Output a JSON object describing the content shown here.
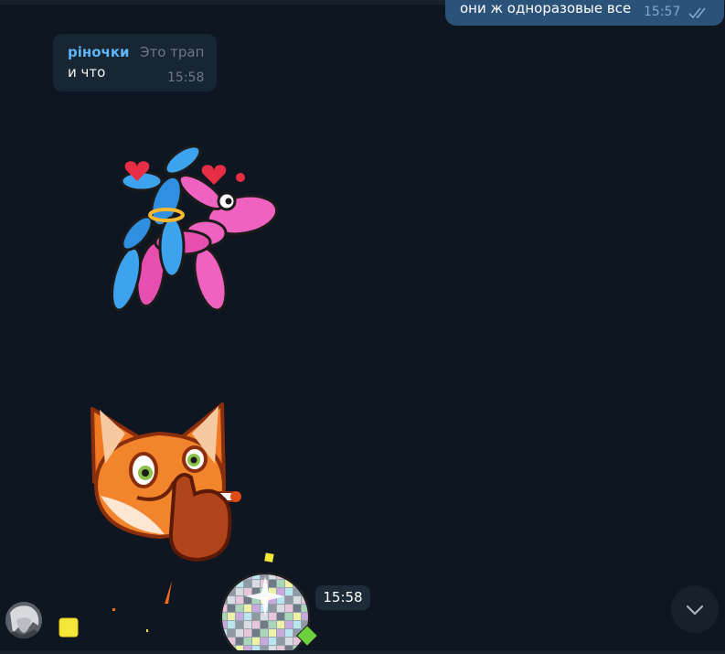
{
  "messages": {
    "outgoing_top": {
      "text": "они ж одноразовые все",
      "time": "15:57",
      "status_icon": "double-check-icon"
    },
    "incoming_reply": {
      "author": "ріночки",
      "quote": "Это трап",
      "text": "и что",
      "time": "15:58"
    },
    "sticker_balloon_dogs": {
      "name": "balloon-dogs-sticker"
    },
    "sticker_fox": {
      "name": "fox-smoking-sticker"
    },
    "sticker_disco": {
      "name": "disco-ball-sticker",
      "time": "15:58"
    }
  },
  "icons": {
    "scroll_down": "chevron-down-icon"
  },
  "colors": {
    "background": "#0e1621",
    "outgoing_bubble": "#2b5278",
    "incoming_bubble": "#182533",
    "author_name": "#5eb5f7",
    "muted_text": "#6c7883"
  }
}
